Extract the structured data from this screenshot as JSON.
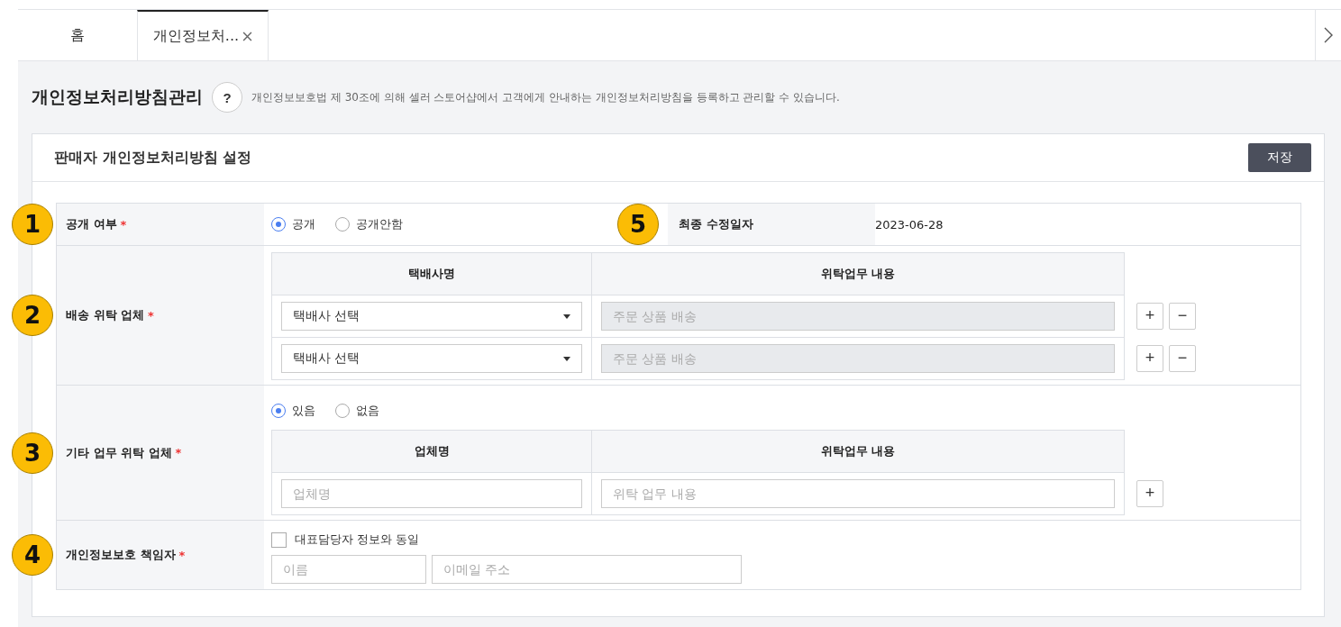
{
  "tabs": [
    {
      "label": "홈",
      "selected": false,
      "closable": false
    },
    {
      "label": "개인정보처...",
      "selected": true,
      "closable": true
    }
  ],
  "page": {
    "title": "개인정보처리방침관리",
    "help": "?",
    "description": "개인정보보호법 제 30조에 의해 셀러 스토어샵에서 고객에게 안내하는 개인정보처리방침을 등록하고 관리할 수 있습니다."
  },
  "panel": {
    "title": "판매자 개인정보처리방침 설정",
    "save_button": "저장"
  },
  "rows": [
    {
      "kind": "radio",
      "badge": "1",
      "label": "공개 여부",
      "required_mark": "*",
      "options": [
        {
          "label": "공개",
          "selected": true
        },
        {
          "label": "공개안함",
          "selected": false
        }
      ],
      "side": {
        "badge": "5",
        "label": "최종 수정일자",
        "value": "2023-06-28"
      }
    },
    {
      "kind": "delivery",
      "badge": "2",
      "label": "배송 위탁 업체",
      "required_mark": "*",
      "columns": [
        "택배사명",
        "위탁업무 내용"
      ],
      "entries": [
        {
          "select": "택배사 선택",
          "placeholder": "주문 상품 배송",
          "disabled": true,
          "buttons": [
            "+",
            "−"
          ]
        },
        {
          "select": "택배사 선택",
          "placeholder": "주문 상품 배송",
          "disabled": true,
          "buttons": [
            "+",
            "−"
          ]
        }
      ]
    },
    {
      "kind": "other",
      "badge": "3",
      "label": "기타 업무 위탁 업체",
      "required_mark": "*",
      "options": [
        {
          "label": "있음",
          "selected": true
        },
        {
          "label": "없음",
          "selected": false
        }
      ],
      "columns": [
        "업체명",
        "위탁업무 내용"
      ],
      "entries": [
        {
          "name_placeholder": "업체명",
          "placeholder": "위탁 업무 내용",
          "disabled": false,
          "buttons": [
            "+"
          ]
        }
      ]
    },
    {
      "kind": "manager",
      "badge": "4",
      "label": "개인정보보호 책임자",
      "required_mark": "*",
      "checkbox": {
        "label": "대표담당자 정보와 동일",
        "checked": false
      },
      "fields": [
        {
          "placeholder": "이름"
        },
        {
          "placeholder": "이메일 주소"
        }
      ]
    }
  ]
}
